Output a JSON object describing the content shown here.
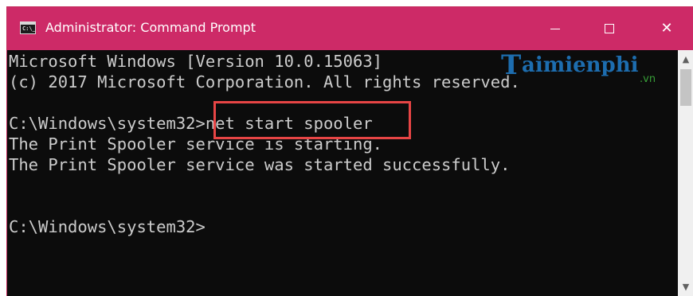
{
  "window": {
    "title": "Administrator: Command Prompt",
    "icon_text": "C:\\_",
    "minimize_glyph": "—",
    "maximize_glyph": "☐",
    "close_glyph": "✕"
  },
  "console": {
    "lines": [
      "Microsoft Windows [Version 10.0.15063]",
      "(c) 2017 Microsoft Corporation. All rights reserved.",
      "",
      "C:\\Windows\\system32>net start spooler",
      "The Print Spooler service is starting.",
      "The Print Spooler service was started successfully.",
      "",
      "",
      "C:\\Windows\\system32>"
    ]
  },
  "watermark": {
    "t": "T",
    "rest": "aimienphi",
    "vn": ".vn"
  },
  "scrollbar": {
    "up_glyph": "▲",
    "down_glyph": "▼"
  },
  "colors": {
    "titlebar": "#cd2a67",
    "console_bg": "#0c0c0c",
    "console_text": "#cccccc",
    "highlight": "#e74545",
    "watermark_blue": "#1e73b8",
    "watermark_green": "#3aa63a"
  },
  "icons": {
    "app": "cmd-icon",
    "minimize": "minimize-icon",
    "maximize": "maximize-icon",
    "close": "close-icon",
    "scroll_up": "chevron-up-icon",
    "scroll_down": "chevron-down-icon"
  }
}
